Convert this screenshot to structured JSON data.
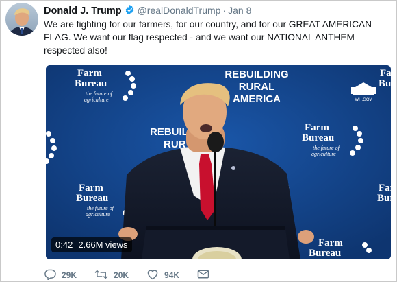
{
  "tweet": {
    "author_name": "Donald J. Trump",
    "handle": "@realDonaldTrump",
    "separator": "·",
    "date": "Jan 8",
    "text": "We are fighting for our farmers, for our country, and for our GREAT AMERICAN FLAG. We want our flag respected - and we want our NATIONAL ANTHEM respected also!"
  },
  "video": {
    "duration": "0:42",
    "views": "2.66M views",
    "backdrop": {
      "logo_line1": "Farm",
      "logo_line2": "Bureau",
      "logo_tagline1": "the future of",
      "logo_tagline2": "agriculture",
      "banner_line1": "REBUILDING",
      "banner_line2": "RURAL",
      "banner_line3": "AMERICA",
      "banner_partial1": "REBUIL",
      "banner_partial2": "RUR",
      "seal_text": "WH.GOV"
    }
  },
  "actions": {
    "replies": "29K",
    "retweets": "20K",
    "likes": "94K"
  },
  "colors": {
    "verified_badge": "#1da1f2",
    "backdrop_blue": "#123d7e",
    "text_muted": "#657786"
  },
  "icons": [
    "verified-badge-icon",
    "reply-icon",
    "retweet-icon",
    "like-icon",
    "mail-icon"
  ]
}
